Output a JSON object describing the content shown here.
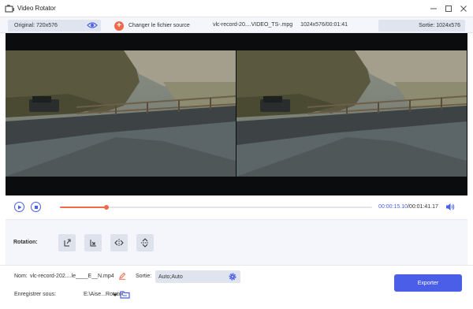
{
  "window": {
    "title": "Video Rotator",
    "controls": [
      "minimize",
      "maximize",
      "close"
    ]
  },
  "infobar": {
    "original_label": "Original: 720x576",
    "change_source_label": "Changer le fichier source",
    "file_name": "vlc-record-20....VIDEO_TS-.mpg",
    "file_details": "1024x576/00:01:41",
    "output_label": "Sortie: 1024x576"
  },
  "player": {
    "current_time": "00:00:15.10",
    "total_time": "/00:01:41.17",
    "progress_fraction": 0.15
  },
  "rotation": {
    "label": "Rotation:",
    "buttons": [
      "rotate-left",
      "rotate-right",
      "flip-horizontal",
      "flip-vertical"
    ]
  },
  "bottom": {
    "name_label": "Nom:",
    "name_value": "vlc-record-202....le____E__N.mp4",
    "output_label": "Sortie:",
    "output_value": "Auto;Auto",
    "save_label": "Enregistrer sous:",
    "save_path": "E:\\Aise...Rotator",
    "export_label": "Exporter"
  },
  "colors": {
    "accent": "#4a5ee8",
    "progress": "#ef6a4a",
    "panel": "#f4f6fb"
  }
}
